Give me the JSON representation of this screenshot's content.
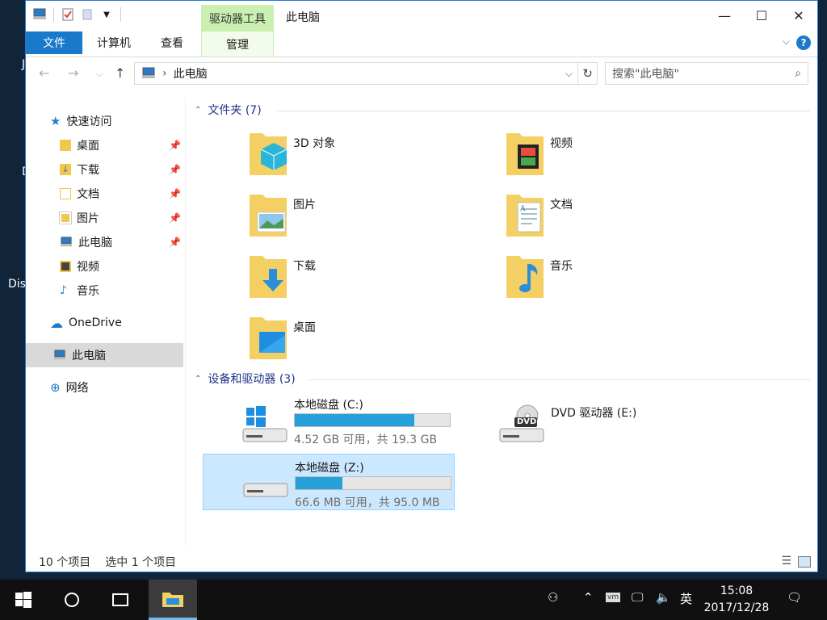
{
  "desktop": {
    "label_j": "J",
    "label_dis": "Dis",
    "label_d": "D"
  },
  "titlebar": {
    "title": "此电脑",
    "context_tab_group": "驱动器工具",
    "minimize": "—",
    "maximize": "☐",
    "close": "✕"
  },
  "ribbon": {
    "tabs": [
      "文件",
      "计算机",
      "查看",
      "管理"
    ],
    "help": "?"
  },
  "address": {
    "path": "此电脑",
    "search_placeholder": "搜索\"此电脑\""
  },
  "sidebar": {
    "quick_access": "快速访问",
    "items": [
      {
        "label": "桌面",
        "pinned": true
      },
      {
        "label": "下载",
        "pinned": true
      },
      {
        "label": "文档",
        "pinned": true
      },
      {
        "label": "图片",
        "pinned": true
      },
      {
        "label": "此电脑",
        "pinned": true
      },
      {
        "label": "视频",
        "pinned": false
      },
      {
        "label": "音乐",
        "pinned": false
      }
    ],
    "onedrive": "OneDrive",
    "this_pc": "此电脑",
    "network": "网络"
  },
  "content": {
    "folders_header": "文件夹 (7)",
    "folders": [
      "3D 对象",
      "视频",
      "图片",
      "文档",
      "下载",
      "音乐",
      "桌面"
    ],
    "devices_header": "设备和驱动器 (3)",
    "drives": [
      {
        "name": "本地磁盘 (C:)",
        "size_text": "4.52 GB 可用，共 19.3 GB",
        "used_fraction": 0.77
      },
      {
        "name": "DVD 驱动器 (E:)",
        "dvd_label": "DVD"
      },
      {
        "name": "本地磁盘 (Z:)",
        "size_text": "66.6 MB 可用，共 95.0 MB",
        "used_fraction": 0.3
      }
    ]
  },
  "statusbar": {
    "item_count": "10 个项目",
    "selected_count": "选中 1 个项目"
  },
  "taskbar": {
    "time": "15:08",
    "date": "2017/12/28",
    "ime": "英"
  },
  "colors": {
    "accent": "#1979ca",
    "context_tab": "#c9efb1",
    "progress": "#26a0da",
    "selection": "#cce8ff",
    "header_text": "#1e3287"
  }
}
